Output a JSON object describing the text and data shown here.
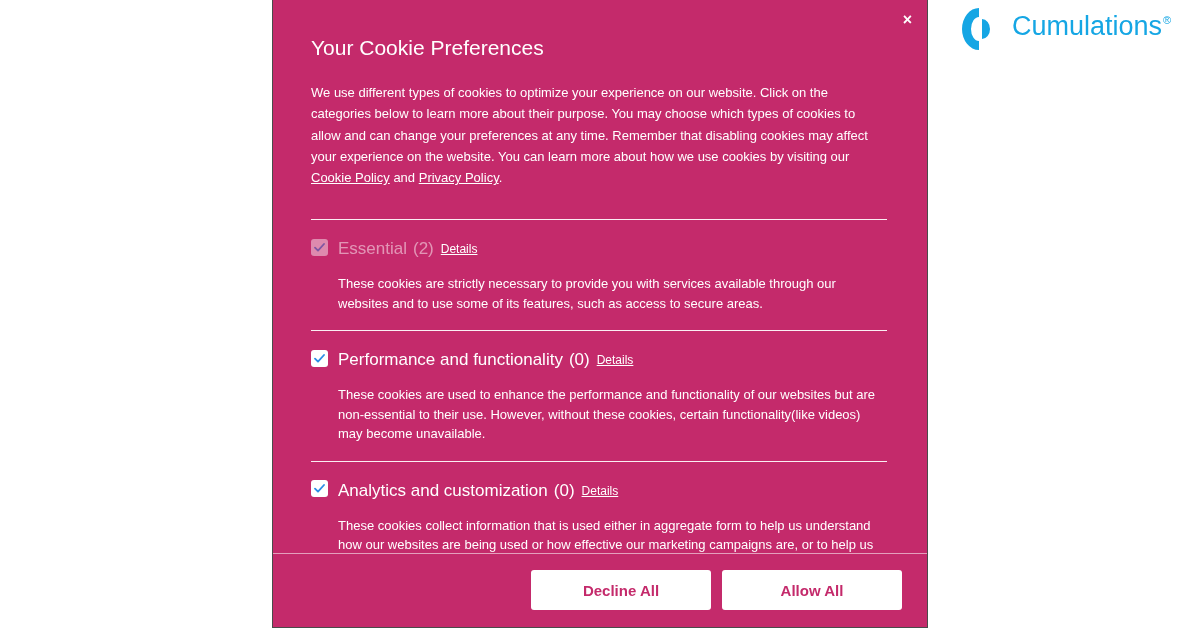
{
  "dialog": {
    "close": "×",
    "title": "Your Cookie Preferences",
    "intro": {
      "text": "We use different types of cookies to optimize your experience on our website. Click on the categories below to learn more about their purpose. You may choose which types of cookies to allow and can change your preferences at any time. Remember that disabling cookies may affect your experience on the website. You can learn more about how we use cookies by visiting our",
      "links": [
        "Cookie Policy",
        "Privacy Policy"
      ],
      "joiner": "and",
      "end": "."
    },
    "categories": [
      {
        "name": "Essential",
        "count": "(2)",
        "details": "Details",
        "checked": true,
        "disabled": true,
        "description": "These cookies are strictly necessary to provide you with services available through our websites and to use some of its features, such as access to secure areas."
      },
      {
        "name": "Performance and functionality",
        "count": "(0)",
        "details": "Details",
        "checked": true,
        "disabled": false,
        "description": "These cookies are used to enhance the performance and functionality of our websites but are non-essential to their use. However, without these cookies, certain functionality(like videos) may become unavailable."
      },
      {
        "name": "Analytics and customization",
        "count": "(0)",
        "details": "Details",
        "checked": true,
        "disabled": false,
        "description": "These cookies collect information that is used either in aggregate form to help us understand how our websites are being used or how effective our marketing campaigns are, or to help us"
      }
    ],
    "buttons": [
      "Decline All",
      "Allow All"
    ]
  },
  "logo": {
    "text": "Cumulations$^{®}$"
  }
}
